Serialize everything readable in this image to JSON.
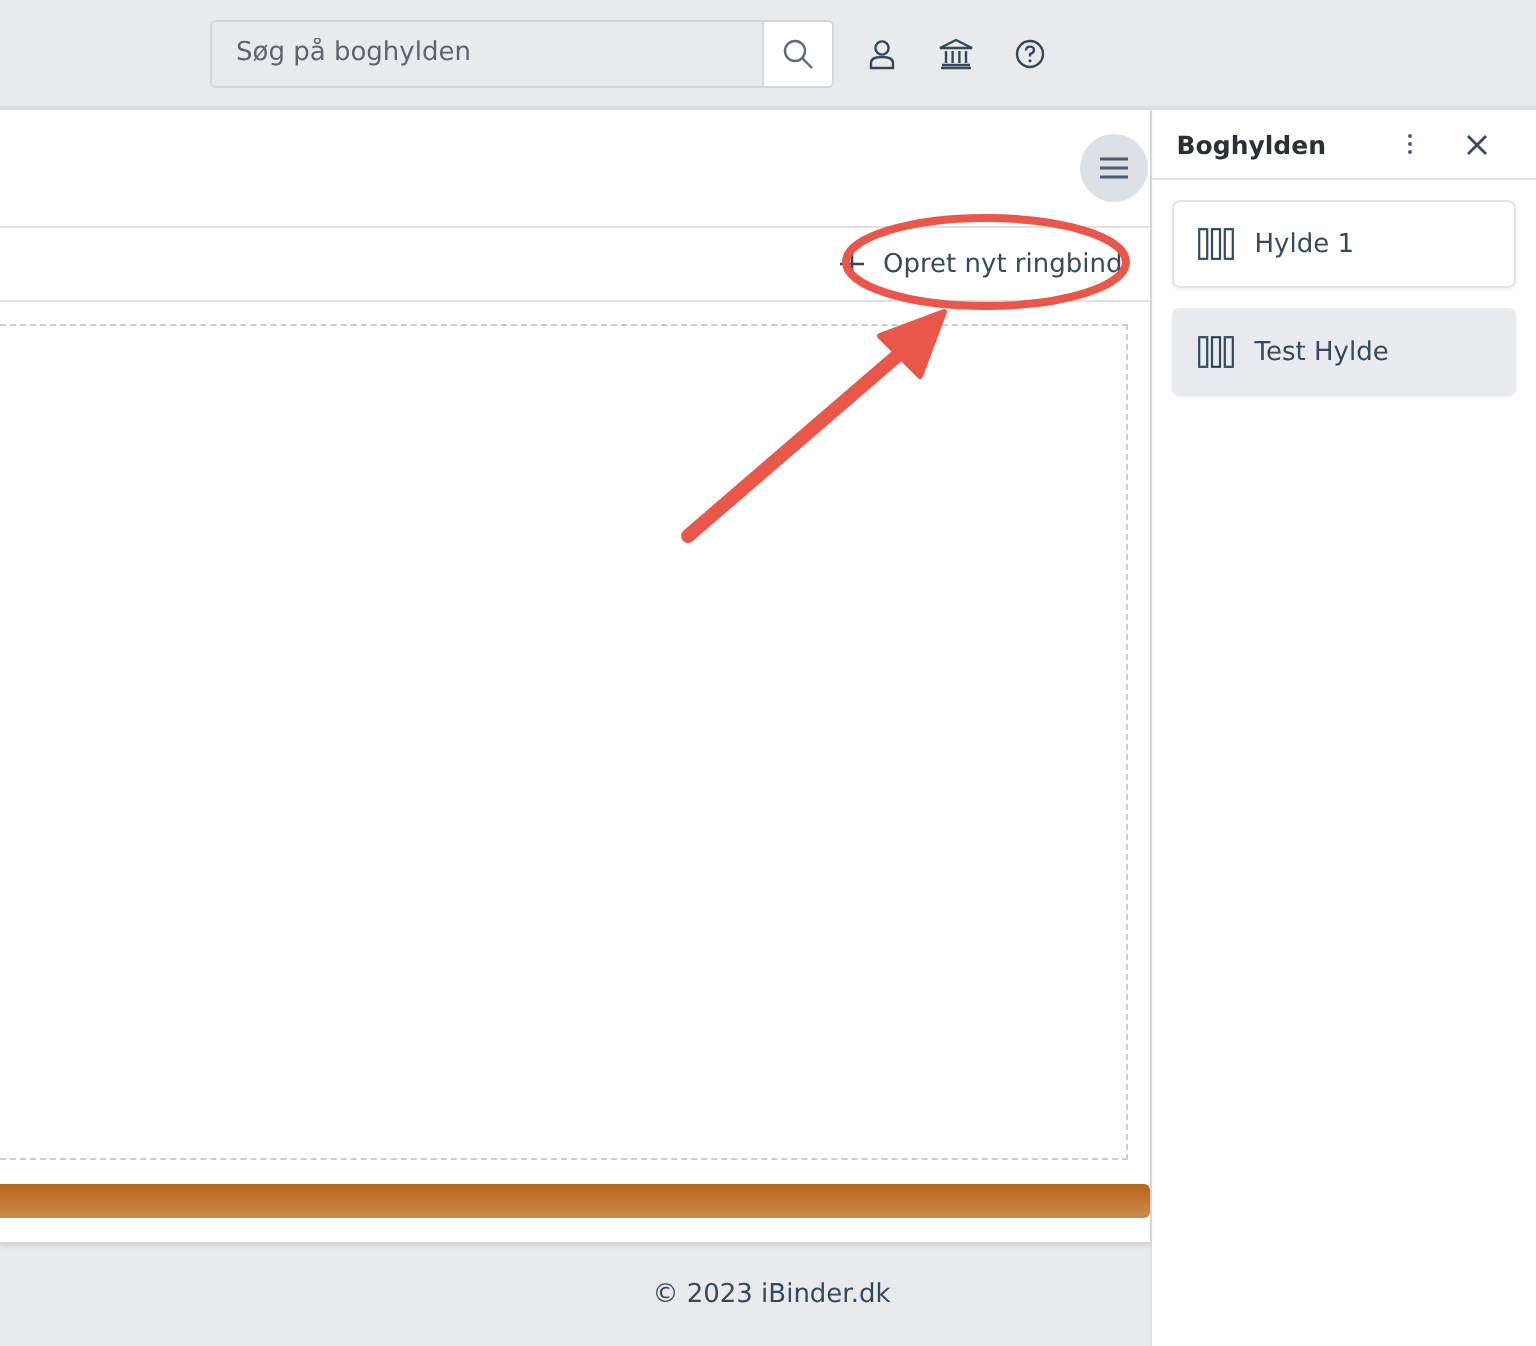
{
  "search": {
    "placeholder": "Søg på boghylden"
  },
  "toolbar": {
    "create_button": "Opret nyt ringbind"
  },
  "sidebar": {
    "title": "Boghylden",
    "items": [
      {
        "label": "Hylde 1",
        "selected": false
      },
      {
        "label": "Test Hylde",
        "selected": true
      }
    ]
  },
  "footer": {
    "copyright": "© 2023 iBinder.dk"
  }
}
